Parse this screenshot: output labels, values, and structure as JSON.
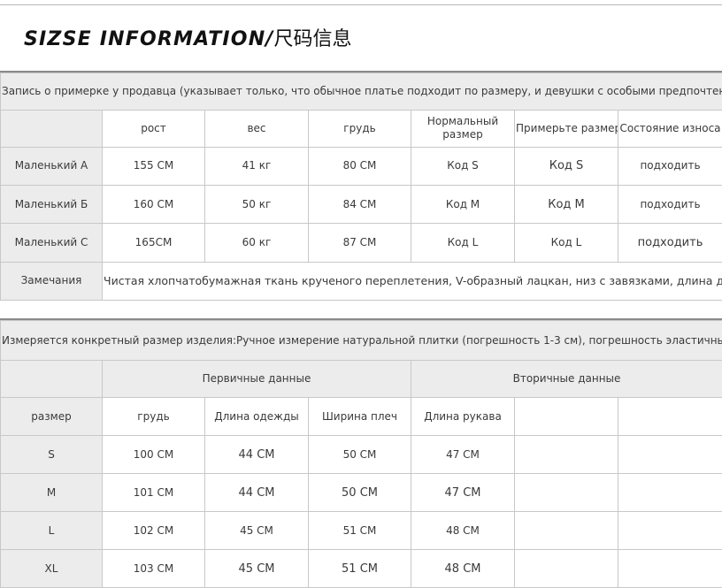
{
  "title": {
    "main": "SIZSE INFORMATION/",
    "cn": "尺码信息"
  },
  "fitting": {
    "note": "Запись о примерке у продавца (указывает только, что обычное платье подходит по размеру, и девушки с особыми предпочтениями должны выбирать в соответствии с реальными потребностями)",
    "headers": [
      "",
      "рост",
      "вес",
      "грудь",
      "Нормальный размер",
      "Примерьте размер",
      "Состояние износа"
    ],
    "rows": [
      [
        "Маленький A",
        "155 CM",
        "41 кг",
        "80 CM",
        "Код S",
        "Код S",
        "подходить"
      ],
      [
        "Маленький Б",
        "160 CM",
        "50 кг",
        "84 CM",
        "Код M",
        "Код M",
        "подходить"
      ],
      [
        "Маленький C",
        "165CM",
        "60 кг",
        "87 CM",
        "Код L",
        "Код L",
        "подходить"
      ]
    ],
    "remarks_label": "Замечания",
    "remarks_text": "Чистая хлопчатобумажная ткань крученого переплетения, V-образный лацкан, низ с завязками, длина до пупка"
  },
  "sizes": {
    "note": "Измеряется конкретный размер изделия:Ручное измерение натуральной плитки (погрешность 1-3 см), погрешность эластичных тканей будет больше.",
    "group_primary": "Первичные данные",
    "group_secondary": "Вторичные данные",
    "headers": [
      "размер",
      "грудь",
      "Длина одежды",
      "Ширина плеч",
      "Длина рукава",
      "",
      ""
    ],
    "rows": [
      [
        "S",
        "100 CM",
        "44 CM",
        "50 CM",
        "47 CM",
        "",
        ""
      ],
      [
        "M",
        "101 CM",
        "44 CM",
        "50 CM",
        "47 CM",
        "",
        ""
      ],
      [
        "L",
        "102 CM",
        "45 CM",
        "51 CM",
        "48 CM",
        "",
        ""
      ],
      [
        "XL",
        "103 CM",
        "45 CM",
        "51 CM",
        "48 CM",
        "",
        ""
      ]
    ]
  }
}
